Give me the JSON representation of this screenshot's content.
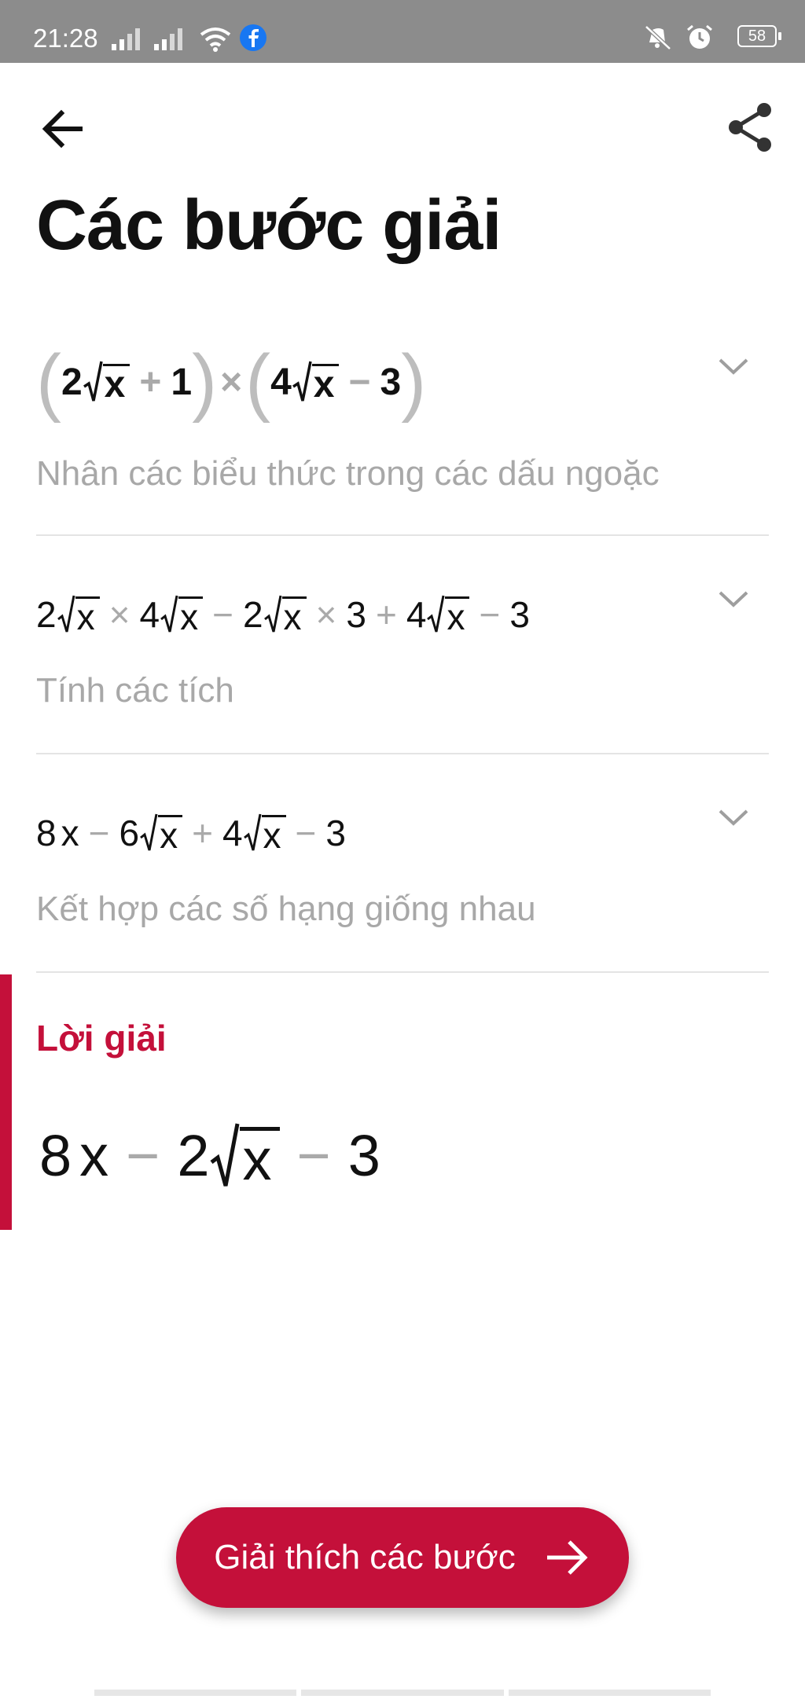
{
  "status_bar": {
    "time": "21:28",
    "battery": "58"
  },
  "header": {
    "title": "Các bước giải"
  },
  "steps": [
    {
      "expression": {
        "a": "2",
        "x": "x",
        "plus": "+",
        "one": "1",
        "times": "×",
        "b": "4",
        "minus": "−",
        "three": "3"
      },
      "description": "Nhân các biểu thức trong các dấu ngoặc"
    },
    {
      "expression": {
        "t1": "2",
        "x": "x",
        "times": "×",
        "t2": "4",
        "minus": "−",
        "t3": "2",
        "t4": "3",
        "plus": "+",
        "t5": "4",
        "t6": "3"
      },
      "description": "Tính các tích"
    },
    {
      "expression": {
        "t1": "8",
        "x": "x",
        "minus": "−",
        "t2": "6",
        "plus": "+",
        "t3": "4",
        "t4": "3"
      },
      "description": "Kết hợp các số hạng giống nhau"
    }
  ],
  "solution": {
    "label": "Lời giải",
    "expression": {
      "t1": "8",
      "x": "x",
      "minus": "−",
      "t2": "2",
      "t3": "3"
    }
  },
  "explain_button": {
    "label": "Giải thích các bước"
  },
  "colors": {
    "accent": "#c4103a",
    "status_bar": "#8c8c8c",
    "description": "#a8a8a8"
  }
}
